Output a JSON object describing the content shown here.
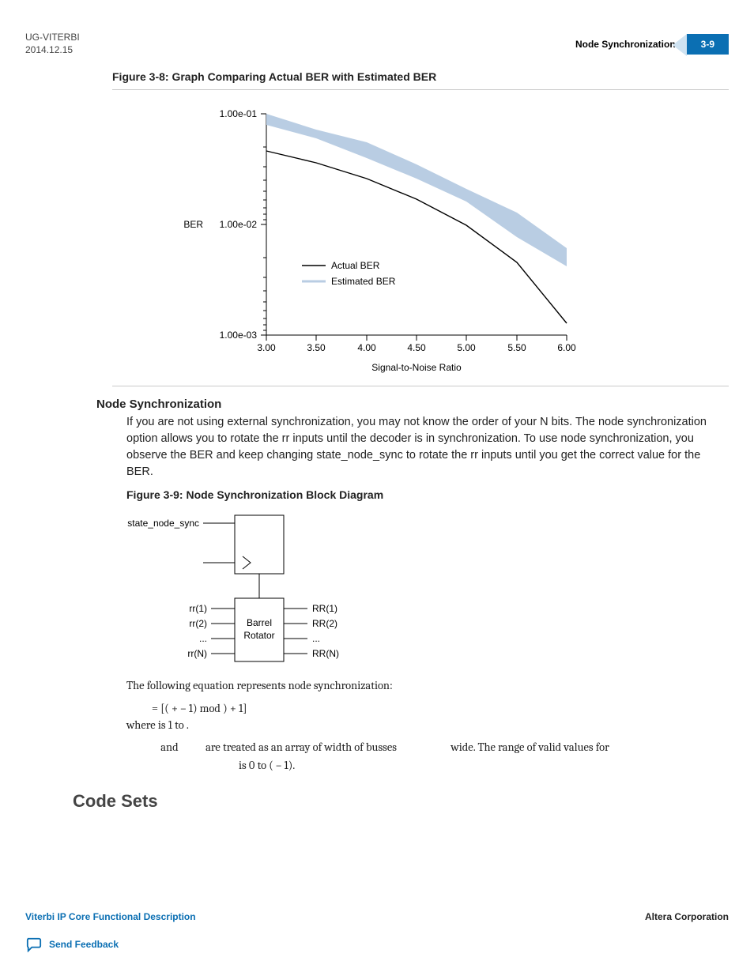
{
  "header": {
    "doc_id": "UG-VITERBI",
    "date": "2014.12.15",
    "section_title": "Node Synchronization",
    "page_num": "3-9"
  },
  "figure8": {
    "caption": "Figure 3-8: Graph Comparing Actual BER with Estimated BER",
    "ylabel": "BER",
    "xlabel": "Signal-to-Noise Ratio",
    "yticks": [
      "1.00e-01",
      "1.00e-02",
      "1.00e-03"
    ],
    "xticks": [
      "3.00",
      "3.50",
      "4.00",
      "4.50",
      "5.00",
      "5.50",
      "6.00"
    ],
    "legend_actual": "Actual BER",
    "legend_est": "Estimated BER"
  },
  "node_sync": {
    "heading": "Node Synchronization",
    "para": "If you are not using external synchronization, you may not know the order of your N bits. The node synchronization option allows you to rotate the rr inputs until the decoder is in synchronization. To use node synchronization, you observe the BER and keep changing state_node_sync to rotate the rr inputs until you get the correct value for the BER.",
    "figure9_caption": "Figure 3-9: Node Synchronization Block Diagram",
    "block_input": "state_node_sync",
    "block_label": "Barrel\nRotator",
    "rr_in": [
      "rr(1)",
      "rr(2)",
      "...",
      "rr(N)"
    ],
    "rr_out": [
      "RR(1)",
      "RR(2)",
      "...",
      "RR(N)"
    ],
    "eq_intro": "The following equation represents node synchronization:",
    "eq": "=    [(                                   +    – 1) mod   ) + 1]",
    "where": "where   is 1 to   .",
    "busses": {
      "part1": "and",
      "part2": "are treated as an array of width   of busses",
      "part3": "wide. The range of valid values for",
      "part4": "is 0 to (   – 1)."
    }
  },
  "code_sets_heading": "Code Sets",
  "footer": {
    "title": "Viterbi IP Core Functional Description",
    "corp": "Altera Corporation",
    "feedback": "Send Feedback"
  },
  "chart_data": {
    "type": "line",
    "title": "Graph Comparing Actual BER with Estimated BER",
    "xlabel": "Signal-to-Noise Ratio",
    "ylabel": "BER",
    "xlim": [
      3.0,
      6.0
    ],
    "ylim": [
      0.001,
      0.1
    ],
    "yscale": "log",
    "x": [
      3.0,
      3.5,
      4.0,
      4.5,
      5.0,
      5.5,
      6.0
    ],
    "series": [
      {
        "name": "Actual BER",
        "values": [
          0.046,
          0.036,
          0.026,
          0.017,
          0.01,
          0.0045,
          0.0013
        ]
      },
      {
        "name": "Estimated BER (lower bound)",
        "values": [
          0.08,
          0.06,
          0.04,
          0.025,
          0.015,
          0.009,
          0.005
        ]
      },
      {
        "name": "Estimated BER (upper bound)",
        "values": [
          0.1,
          0.09,
          0.072,
          0.05,
          0.03,
          0.015,
          0.007
        ]
      }
    ]
  }
}
